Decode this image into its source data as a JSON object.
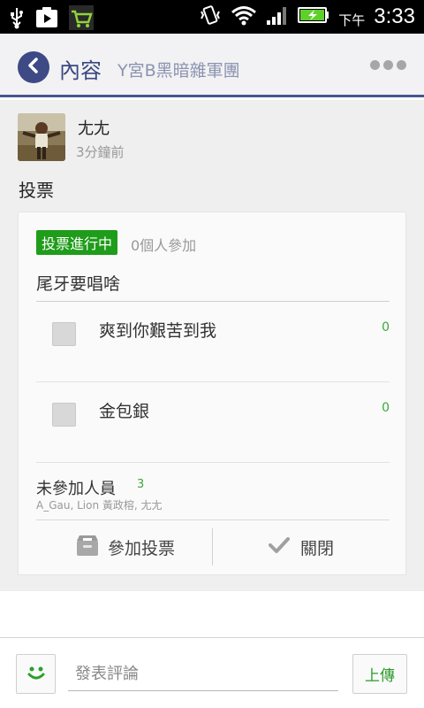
{
  "status_bar": {
    "left_icons": [
      "usb-icon",
      "play-store-icon",
      "shopping-cart-icon"
    ],
    "right_icons": [
      "vibrate-icon",
      "wifi-icon",
      "signal-icon",
      "battery-charging-icon"
    ],
    "ampm": "下午",
    "time": "3:33"
  },
  "header": {
    "back_icon": "chevron-left-icon",
    "title": "內容",
    "subtitle": "Y宮B黑暗雜軍團",
    "more_icon": "more-dots-icon"
  },
  "post": {
    "author": "尢尢",
    "time_ago": "3分鐘前",
    "type": "投票"
  },
  "poll": {
    "status_badge": "投票進行中",
    "participants": "0個人參加",
    "question": "尾牙要唱啥",
    "options": [
      {
        "label": "爽到你艱苦到我",
        "count": "0"
      },
      {
        "label": "金包銀",
        "count": "0"
      }
    ],
    "not_participated": {
      "label": "未參加人員",
      "count": "3",
      "names": "A_Gau, Lion 黃政榕, 尢尢"
    },
    "actions": {
      "join_label": "參加投票",
      "close_label": "關閉"
    }
  },
  "comment_bar": {
    "placeholder": "發表評論",
    "upload_label": "上傳"
  },
  "colors": {
    "accent": "#3d4a85",
    "badge_green": "#1f9c1a",
    "count_green": "#3aa83a"
  }
}
